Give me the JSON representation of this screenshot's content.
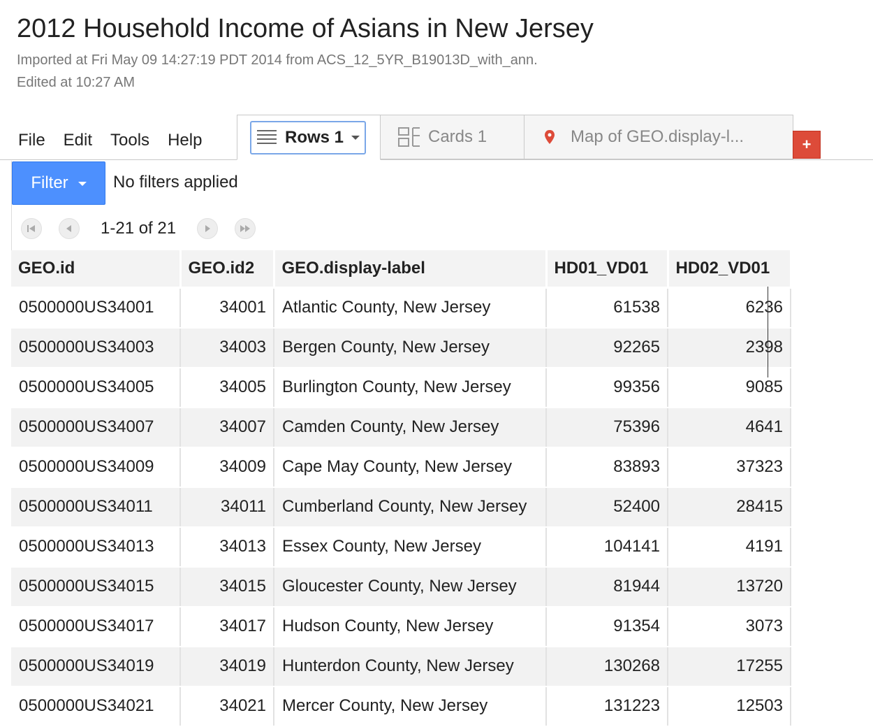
{
  "header": {
    "title": "2012 Household Income of Asians in New Jersey",
    "imported": "Imported at Fri May 09 14:27:19 PDT 2014 from ACS_12_5YR_B19013D_with_ann.",
    "edited": "Edited at 10:27 AM"
  },
  "menu": [
    "File",
    "Edit",
    "Tools",
    "Help"
  ],
  "tabs": {
    "rows": "Rows 1",
    "cards": "Cards 1",
    "map": "Map of GEO.display-l...",
    "add": "+"
  },
  "filter": {
    "button": "Filter",
    "status": "No filters applied"
  },
  "pager": {
    "range": "1-21 of 21"
  },
  "table": {
    "columns": [
      "GEO.id",
      "GEO.id2",
      "GEO.display-label",
      "HD01_VD01",
      "HD02_VD01"
    ],
    "rows": [
      [
        "0500000US34001",
        "34001",
        "Atlantic County, New Jersey",
        "61538",
        "6236"
      ],
      [
        "0500000US34003",
        "34003",
        "Bergen County, New Jersey",
        "92265",
        "2398"
      ],
      [
        "0500000US34005",
        "34005",
        "Burlington County, New Jersey",
        "99356",
        "9085"
      ],
      [
        "0500000US34007",
        "34007",
        "Camden County, New Jersey",
        "75396",
        "4641"
      ],
      [
        "0500000US34009",
        "34009",
        "Cape May County, New Jersey",
        "83893",
        "37323"
      ],
      [
        "0500000US34011",
        "34011",
        "Cumberland County, New Jersey",
        "52400",
        "28415"
      ],
      [
        "0500000US34013",
        "34013",
        "Essex County, New Jersey",
        "104141",
        "4191"
      ],
      [
        "0500000US34015",
        "34015",
        "Gloucester County, New Jersey",
        "81944",
        "13720"
      ],
      [
        "0500000US34017",
        "34017",
        "Hudson County, New Jersey",
        "91354",
        "3073"
      ],
      [
        "0500000US34019",
        "34019",
        "Hunterdon County, New Jersey",
        "130268",
        "17255"
      ],
      [
        "0500000US34021",
        "34021",
        "Mercer County, New Jersey",
        "131223",
        "12503"
      ]
    ]
  }
}
